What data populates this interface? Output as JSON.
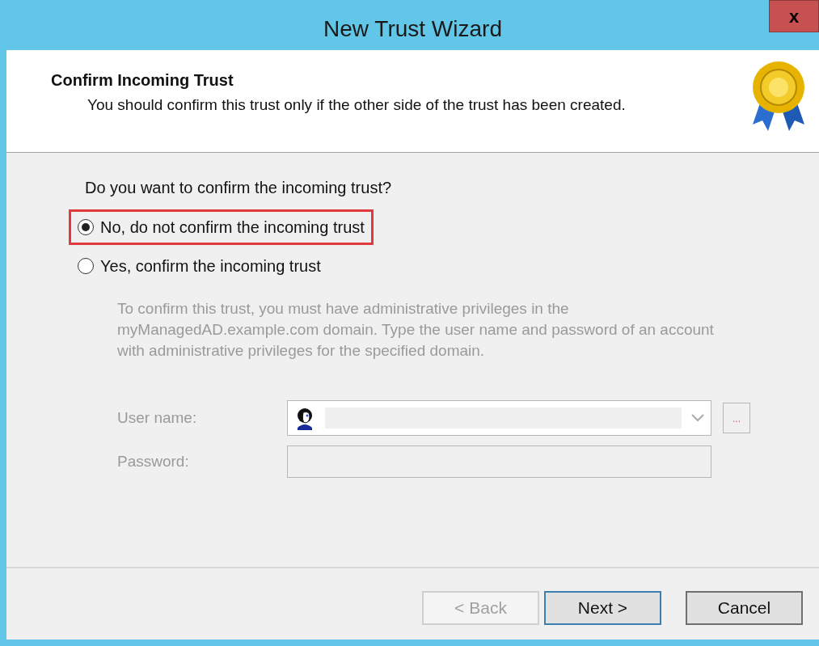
{
  "window": {
    "title": "New Trust Wizard",
    "close_label": "x"
  },
  "header": {
    "title": "Confirm Incoming Trust",
    "subtitle": "You should confirm this trust only if the other side of the trust has been created."
  },
  "question": "Do you want to confirm the incoming trust?",
  "options": [
    {
      "label": "No, do not confirm the incoming trust",
      "selected": true,
      "highlighted": true
    },
    {
      "label": "Yes, confirm the incoming trust",
      "selected": false,
      "highlighted": false
    }
  ],
  "note": "To confirm this trust, you must have administrative privileges in the myManagedAD.example.com domain. Type the user name and password of an account with administrative privileges for the specified domain.",
  "fields": [
    {
      "kind": "combo",
      "label": "User name:",
      "disabled": true,
      "browse_label": "..."
    },
    {
      "kind": "password",
      "label": "Password:",
      "disabled": true
    }
  ],
  "buttons": [
    {
      "label": "< Back",
      "disabled": true,
      "default": false
    },
    {
      "label": "Next >",
      "disabled": false,
      "default": true
    },
    {
      "label": "Cancel",
      "disabled": false,
      "default": false
    }
  ]
}
